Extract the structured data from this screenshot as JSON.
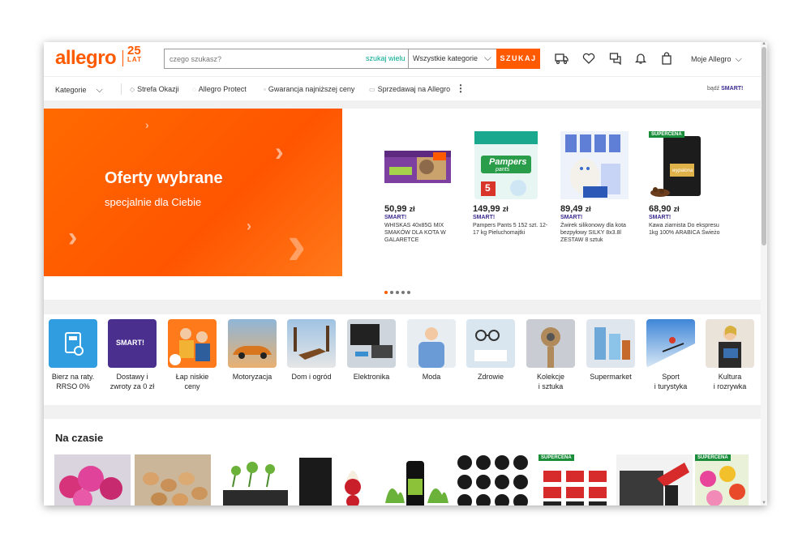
{
  "header": {
    "logo_text": "allegro",
    "logo_badge_number": "25",
    "logo_badge_text": "LAT",
    "search_placeholder": "czego szukasz?",
    "search_many_label": "szukaj wielu",
    "category_select_value": "Wszystkie kategorie",
    "search_button_label": "SZUKAJ",
    "my_allegro_label": "Moje Allegro",
    "icons": [
      "delivery-truck-icon",
      "heart-icon",
      "chat-icon",
      "bell-icon",
      "shopping-bag-icon"
    ]
  },
  "nav": {
    "categories_label": "Kategorie",
    "items": [
      {
        "label": "Strefa Okazji",
        "icon": "tag-icon"
      },
      {
        "label": "Allegro Protect",
        "icon": "shield-icon"
      },
      {
        "label": "Gwarancja najniższej ceny",
        "icon": "badge-icon"
      },
      {
        "label": "Sprzedawaj na Allegro",
        "icon": "store-icon"
      }
    ],
    "smart_prefix": "bądź",
    "smart_label": "SMART!"
  },
  "banner": {
    "title": "Oferty wybrane",
    "subtitle": "specjalnie dla Ciebie"
  },
  "products": [
    {
      "price_main": "50,99",
      "price_cur": "zł",
      "smart": "SMART!",
      "name": "WHISKAS 40x85G MIX SMAKÓW DLA KOTA W GALARETCE"
    },
    {
      "price_main": "149,99",
      "price_cur": "zł",
      "smart": "SMART!",
      "name": "Pampers Pants 5 152 szt. 12-17 kg Pieluchomajtki"
    },
    {
      "price_main": "89,49",
      "price_cur": "zł",
      "smart": "SMART!",
      "name": "Żwirek silikonowy dla kota bezpyłowy SILKY 8x3.8l ZESTAW 8 sztuk"
    },
    {
      "price_main": "68,90",
      "price_cur": "zł",
      "smart": "SMART!",
      "name": "Kawa ziarnista Do ekspresu 1kg 100% ARABICA Świeżo",
      "badge": "SUPERCENA"
    }
  ],
  "product_images_text": {
    "pampers_brand": "Pampers",
    "pampers_sub": "pants",
    "pampers_size": "5",
    "coffee_label": "wypalona"
  },
  "carousel": {
    "count": 5,
    "active": 0
  },
  "categories": [
    {
      "line1": "Bierz na raty.",
      "line2": "RRSO 0%"
    },
    {
      "line1": "Dostawy i",
      "line2": "zwroty za 0 zł"
    },
    {
      "line1": "Łap niskie",
      "line2": "ceny"
    },
    {
      "line1": "Motoryzacja",
      "line2": ""
    },
    {
      "line1": "Dom i ogród",
      "line2": ""
    },
    {
      "line1": "Elektronika",
      "line2": ""
    },
    {
      "line1": "Moda",
      "line2": ""
    },
    {
      "line1": "Zdrowie",
      "line2": ""
    },
    {
      "line1": "Kolekcje",
      "line2": "i sztuka"
    },
    {
      "line1": "Supermarket",
      "line2": ""
    },
    {
      "line1": "Sport",
      "line2": "i turystyka"
    },
    {
      "line1": "Kultura",
      "line2": "i rozrywka"
    }
  ],
  "category_tile_text": {
    "smart_tile": "SMART!"
  },
  "trending": {
    "title": "Na czasie",
    "badges": [
      "SUPERCENA",
      "SUPERCENA"
    ]
  },
  "colors": {
    "brand": "#ff5a00",
    "smart_purple": "#3b2b8f",
    "teal": "#00a790",
    "supercena_green": "#1a8d3a"
  }
}
